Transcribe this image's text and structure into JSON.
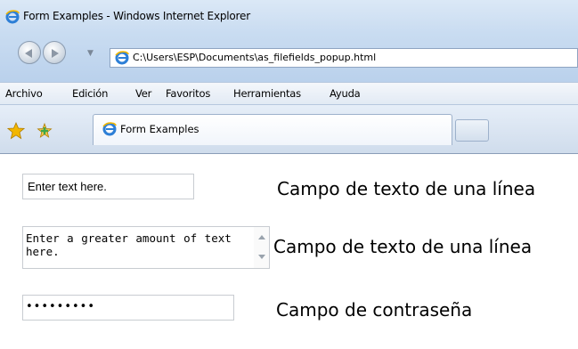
{
  "window": {
    "title": "Form Examples - Windows Internet Explorer"
  },
  "navigation": {
    "address": "C:\\Users\\ESP\\Documents\\as_filefields_popup.html",
    "dropdown_glyph": "▼"
  },
  "menu": {
    "items": [
      "Archivo",
      "Edición",
      "Ver",
      "Favoritos",
      "Herramientas",
      "Ayuda"
    ]
  },
  "tabs": {
    "active_label": "Form Examples"
  },
  "form": {
    "text_field": {
      "value": "Enter text here.",
      "label": "Campo de texto de una línea"
    },
    "textarea": {
      "value": "Enter a greater amount of text here.",
      "label": "Campo de texto de una línea"
    },
    "password_field": {
      "value": "•••••••••",
      "label": "Campo de contraseña"
    }
  },
  "icons": {
    "browser": "ie-icon",
    "favorites": "star-icon",
    "add_favorites": "add-favorite-icon"
  },
  "colors": {
    "chrome_blue": "#c9dcf1",
    "ie_icon": "#2d7fd6",
    "star": "#f2b600",
    "add_fav_green": "#3ea84a"
  }
}
